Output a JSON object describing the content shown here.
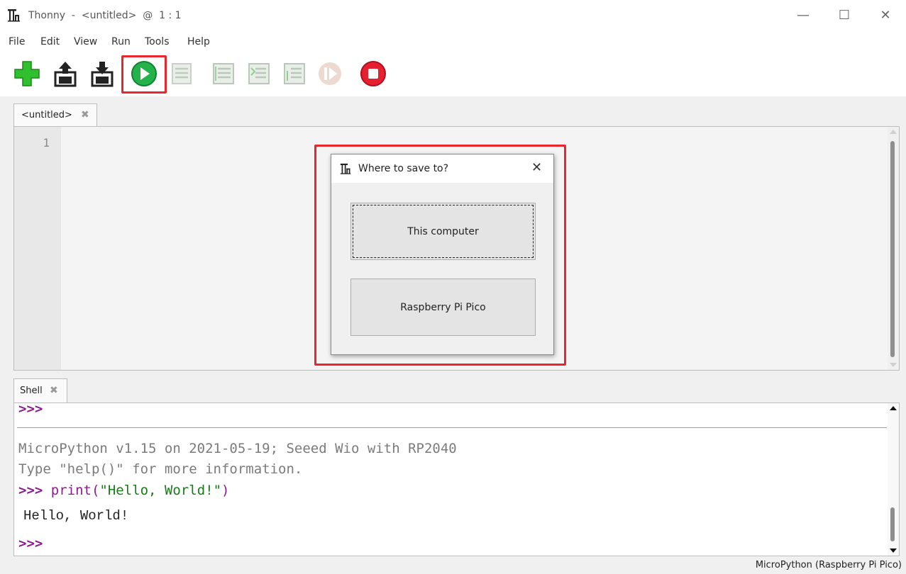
{
  "window": {
    "title": "Thonny  -  <untitled>  @  1 : 1",
    "minimize_glyph": "—",
    "maximize_glyph": "☐",
    "close_glyph": "✕"
  },
  "menu": [
    "File",
    "Edit",
    "View",
    "Run",
    "Tools",
    "Help"
  ],
  "toolbar": {
    "icons": [
      "new-icon",
      "open-icon",
      "save-icon",
      "run-icon",
      "debug-icon",
      "step-over-icon",
      "step-into-icon",
      "step-out-icon",
      "resume-icon",
      "stop-icon"
    ],
    "highlight_color": "#e8262b"
  },
  "editor": {
    "tab_label": "<untitled>",
    "tab_close_glyph": "✖",
    "line_numbers": [
      "1"
    ]
  },
  "dialog": {
    "title": "Where to save to?",
    "close_glyph": "✕",
    "options": [
      "This computer",
      "Raspberry Pi Pico"
    ]
  },
  "shell": {
    "tab_label": "Shell",
    "tab_close_glyph": "✖",
    "prompt": ">>>",
    "banner_line1": "MicroPython v1.15 on 2021-05-19; Seeed Wio with RP2040",
    "banner_line2": "Type \"help()\" for more information.",
    "command_print": "print(",
    "command_string": "\"Hello, World!\"",
    "command_close": ")",
    "output": "Hello, World!"
  },
  "status": {
    "interpreter": "MicroPython (Raspberry Pi Pico)"
  }
}
